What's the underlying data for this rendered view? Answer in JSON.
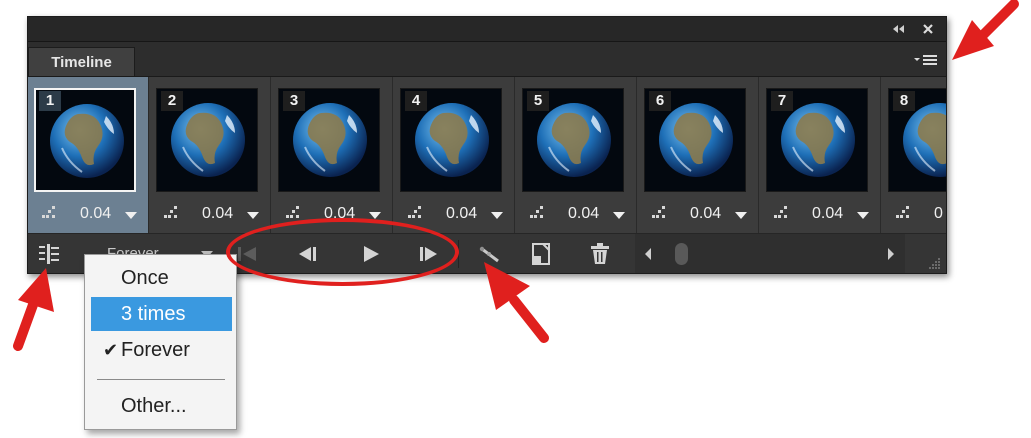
{
  "window": {
    "collapse_icon": "double-chevron-left-icon",
    "close_icon": "close-x-icon"
  },
  "panel": {
    "tab_label": "Timeline",
    "menu_icon": "panel-menu-icon"
  },
  "frames": [
    {
      "number": "1",
      "delay": "0.04",
      "selected": true
    },
    {
      "number": "2",
      "delay": "0.04",
      "selected": false
    },
    {
      "number": "3",
      "delay": "0.04",
      "selected": false
    },
    {
      "number": "4",
      "delay": "0.04",
      "selected": false
    },
    {
      "number": "5",
      "delay": "0.04",
      "selected": false
    },
    {
      "number": "6",
      "delay": "0.04",
      "selected": false
    },
    {
      "number": "7",
      "delay": "0.04",
      "selected": false
    },
    {
      "number": "8",
      "delay": "0",
      "selected": false
    }
  ],
  "toolbar": {
    "convert_icon": "convert-to-video-timeline-icon",
    "loop_value": "Forever",
    "first_frame_icon": "first-frame-icon",
    "prev_frame_icon": "previous-frame-icon",
    "play_icon": "play-icon",
    "next_frame_icon": "next-frame-icon",
    "tween_icon": "tween-icon",
    "duplicate_icon": "duplicate-frame-icon",
    "delete_icon": "trash-icon"
  },
  "loop_menu": {
    "items": [
      {
        "label": "Once",
        "highlighted": false,
        "checked": false
      },
      {
        "label": "3 times",
        "highlighted": true,
        "checked": false
      },
      {
        "label": "Forever",
        "highlighted": false,
        "checked": true
      },
      {
        "label": "Other...",
        "highlighted": false,
        "checked": false
      }
    ],
    "check_glyph": "✔"
  },
  "colors": {
    "annotation_red": "#e0201e",
    "highlight_blue": "#3a99e0",
    "selected_frame": "#6c8092"
  }
}
